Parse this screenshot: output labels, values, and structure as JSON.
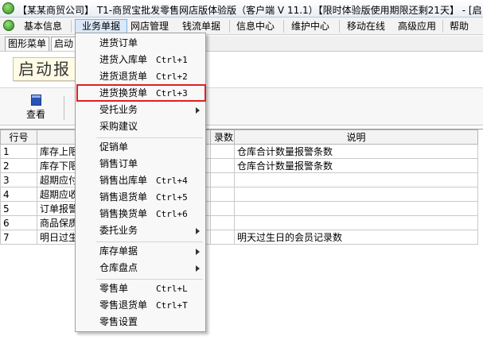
{
  "window": {
    "title": "【某某商贸公司】 T1-商贸宝批发零售网店版体验版（客户端 V 11.1）【限时体验版使用期限还剩21天】 - [启"
  },
  "menubar": {
    "items": [
      "基本信息",
      "业务单据",
      "网店管理",
      "钱流单据",
      "职员业务",
      "信息中心",
      "维护中心",
      "移动在线",
      "高级应用",
      "帮助"
    ]
  },
  "tabs": [
    "图形菜单",
    "启动"
  ],
  "banner": {
    "text": "启动报"
  },
  "toolbar": {
    "view_label": "查看"
  },
  "table": {
    "headers": [
      "行号",
      "",
      "",
      "录数",
      "说明"
    ],
    "rows": [
      {
        "no": "1",
        "name": "库存上限",
        "count": "",
        "desc": "仓库合计数量报警条数"
      },
      {
        "no": "2",
        "name": "库存下限",
        "count": "",
        "desc": "仓库合计数量报警条数"
      },
      {
        "no": "3",
        "name": "超期应付",
        "count": "",
        "desc": ""
      },
      {
        "no": "4",
        "name": "超期应收",
        "count": "",
        "desc": ""
      },
      {
        "no": "5",
        "name": "订单报警",
        "count": "",
        "desc": ""
      },
      {
        "no": "6",
        "name": "商品保质",
        "count": "",
        "desc": ""
      },
      {
        "no": "7",
        "name": "明日过生",
        "count": "",
        "desc": "明天过生日的会员记录数"
      }
    ]
  },
  "dropdown": {
    "items": [
      {
        "label": "进货订单",
        "shortcut": "",
        "submenu": false
      },
      {
        "label": "进货入库单",
        "shortcut": "Ctrl+1",
        "submenu": false
      },
      {
        "label": "进货退货单",
        "shortcut": "Ctrl+2",
        "submenu": false
      },
      {
        "label": "进货换货单",
        "shortcut": "Ctrl+3",
        "submenu": false,
        "highlighted": true
      },
      {
        "label": "受托业务",
        "shortcut": "",
        "submenu": true
      },
      {
        "label": "采购建议",
        "shortcut": "",
        "submenu": false
      },
      {
        "label": "促销单",
        "shortcut": "",
        "submenu": false
      },
      {
        "label": "销售订单",
        "shortcut": "",
        "submenu": false
      },
      {
        "label": "销售出库单",
        "shortcut": "Ctrl+4",
        "submenu": false
      },
      {
        "label": "销售退货单",
        "shortcut": "Ctrl+5",
        "submenu": false
      },
      {
        "label": "销售换货单",
        "shortcut": "Ctrl+6",
        "submenu": false
      },
      {
        "label": "委托业务",
        "shortcut": "",
        "submenu": true
      },
      {
        "label": "库存单据",
        "shortcut": "",
        "submenu": true
      },
      {
        "label": "仓库盘点",
        "shortcut": "",
        "submenu": true
      },
      {
        "label": "零售单",
        "shortcut": "Ctrl+L",
        "submenu": false
      },
      {
        "label": "零售退货单",
        "shortcut": "Ctrl+T",
        "submenu": false
      },
      {
        "label": "零售设置",
        "shortcut": "",
        "submenu": false
      }
    ]
  },
  "colors": {
    "highlight_border": "#e02020",
    "menu_active_bg": "#dbe8f8",
    "menu_active_border": "#7eb4ea"
  }
}
